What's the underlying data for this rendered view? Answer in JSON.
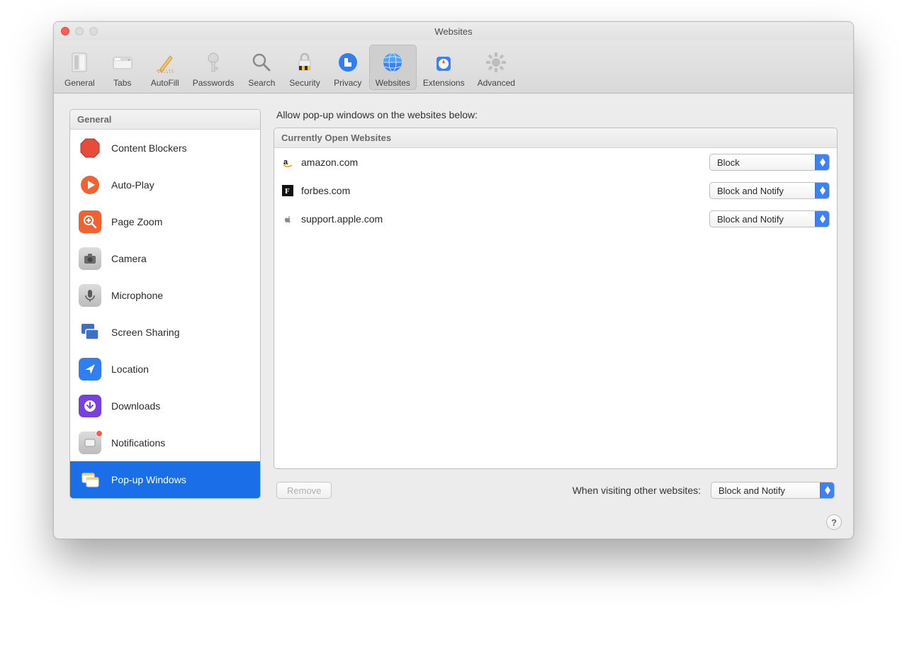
{
  "window": {
    "title": "Websites"
  },
  "toolbar": {
    "items": [
      {
        "label": "General"
      },
      {
        "label": "Tabs"
      },
      {
        "label": "AutoFill"
      },
      {
        "label": "Passwords"
      },
      {
        "label": "Search"
      },
      {
        "label": "Security"
      },
      {
        "label": "Privacy"
      },
      {
        "label": "Websites"
      },
      {
        "label": "Extensions"
      },
      {
        "label": "Advanced"
      }
    ],
    "selected_label": "Websites"
  },
  "sidebar": {
    "header": "General",
    "items": [
      {
        "label": "Content Blockers"
      },
      {
        "label": "Auto-Play"
      },
      {
        "label": "Page Zoom"
      },
      {
        "label": "Camera"
      },
      {
        "label": "Microphone"
      },
      {
        "label": "Screen Sharing"
      },
      {
        "label": "Location"
      },
      {
        "label": "Downloads"
      },
      {
        "label": "Notifications",
        "badge": true
      },
      {
        "label": "Pop-up Windows",
        "selected": true
      }
    ]
  },
  "main": {
    "heading": "Allow pop-up windows on the websites below:",
    "section_header": "Currently Open Websites",
    "rows": [
      {
        "domain": "amazon.com",
        "value": "Block"
      },
      {
        "domain": "forbes.com",
        "value": "Block and Notify"
      },
      {
        "domain": "support.apple.com",
        "value": "Block and Notify"
      }
    ],
    "remove_label": "Remove",
    "other_label": "When visiting other websites:",
    "other_value": "Block and Notify"
  },
  "help_glyph": "?"
}
